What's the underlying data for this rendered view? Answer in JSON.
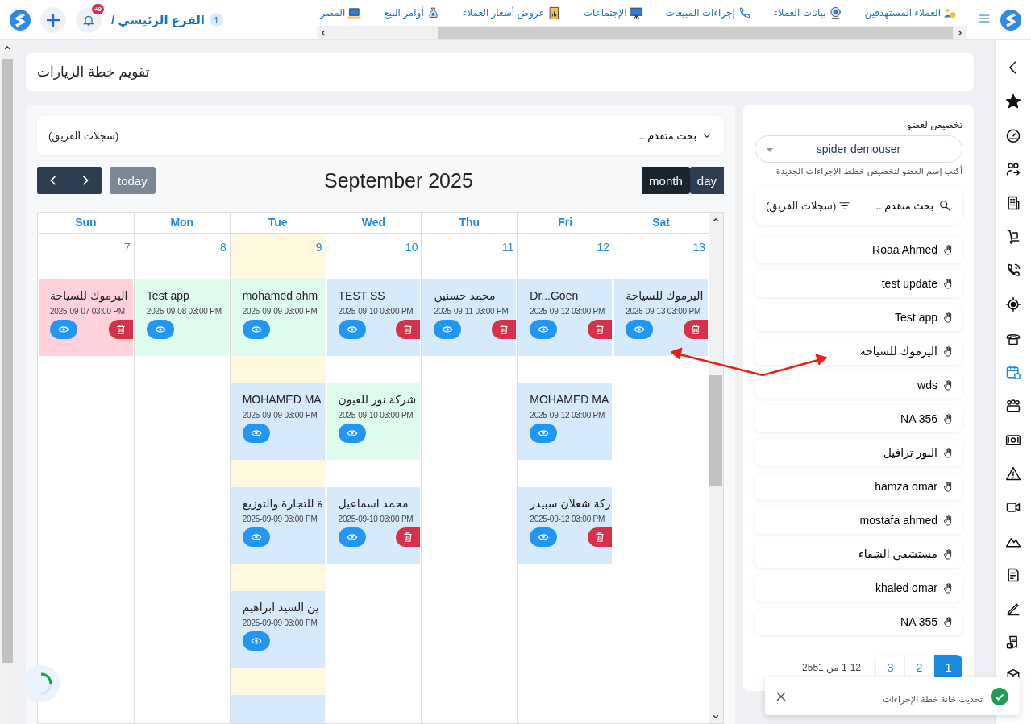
{
  "topbar": {
    "branch": {
      "label": "الفرع الرئيسي /",
      "count": "1"
    },
    "notifications": {
      "badge": "+9"
    },
    "nav_items": [
      {
        "label": "العملاء المستهدفين"
      },
      {
        "label": "بيانات العملاء"
      },
      {
        "label": "إجراءات المبيعات"
      },
      {
        "label": "الإجتماعات"
      },
      {
        "label": "عروض أسعار العملاء"
      },
      {
        "label": "أوامر البيع"
      },
      {
        "label": "المصر"
      }
    ]
  },
  "sidebar": {
    "items": [
      {
        "selected": false
      },
      {
        "selected": false
      },
      {
        "selected": false
      },
      {
        "selected": false
      },
      {
        "selected": false
      },
      {
        "selected": false
      },
      {
        "selected": false
      },
      {
        "selected": false
      },
      {
        "selected": true
      },
      {
        "selected": false
      },
      {
        "selected": false
      },
      {
        "selected": false
      },
      {
        "selected": false
      },
      {
        "selected": false
      },
      {
        "selected": false
      },
      {
        "selected": false
      },
      {
        "selected": false
      },
      {
        "selected": false
      }
    ]
  },
  "page_title": "تقويم خطة الزيارات",
  "calendar": {
    "filter": {
      "search_label": "بحث متقدم...",
      "scope": "(سجلات الفريق)"
    },
    "toolbar": {
      "today": {
        "label": "today",
        "disabled": true
      },
      "title": "September 2025",
      "views": [
        {
          "label": "day",
          "selected": false
        },
        {
          "label": "month",
          "selected": true
        }
      ]
    },
    "days": [
      {
        "name": "Sat",
        "date": "13",
        "today": false,
        "events": [
          {
            "title": "اليرموك للسياحة",
            "time": "2025-09-13 03:00 PM",
            "color": "#d6eafb",
            "deletable": true
          }
        ]
      },
      {
        "name": "Fri",
        "date": "12",
        "today": false,
        "events": [
          {
            "title": "Dr...Goen",
            "time": "2025-09-12 03:00 PM",
            "color": "#d6eafb",
            "deletable": true
          },
          {
            "title": "MOHAMED MA",
            "time": "2025-09-12 03:00 PM",
            "color": "#d6eafb",
            "deletable": false
          },
          {
            "title": "ركة شعلان سبيدر",
            "time": "2025-09-12 03:00 PM",
            "color": "#d6eafb",
            "deletable": true
          }
        ]
      },
      {
        "name": "Thu",
        "date": "11",
        "today": false,
        "events": [
          {
            "title": "محمد حسنين",
            "time": "2025-09-11 03:00 PM",
            "color": "#d6eafb",
            "deletable": true
          }
        ]
      },
      {
        "name": "Wed",
        "date": "10",
        "today": false,
        "events": [
          {
            "title": "TEST SS",
            "time": "2025-09-10 03:00 PM",
            "color": "#d6eafb",
            "deletable": true
          },
          {
            "title": "شركة نور للعيون",
            "time": "2025-09-10 03:00 PM",
            "color": "#dffbec",
            "deletable": false
          },
          {
            "title": "محمد اسماعيل",
            "time": "2025-09-10 03:00 PM",
            "color": "#d6eafb",
            "deletable": true
          }
        ]
      },
      {
        "name": "Tue",
        "date": "9",
        "today": true,
        "events": [
          {
            "title": "mohamed ahm",
            "time": "2025-09-09 03:00 PM",
            "color": "#dffbec",
            "deletable": false
          },
          {
            "title": "MOHAMED MA",
            "time": "2025-09-09 03:00 PM",
            "color": "#d6eafb",
            "deletable": false
          },
          {
            "title": "ة للتجارة والتوزيع",
            "time": "2025-09-09 03:00 PM",
            "color": "#d6eafb",
            "deletable": false
          },
          {
            "title": "ين السيد ابراهيم",
            "time": "2025-09-09 03:00 PM",
            "color": "#d6eafb",
            "deletable": false
          },
          {
            "color": "#d6eafb"
          }
        ]
      },
      {
        "name": "Mon",
        "date": "8",
        "today": false,
        "events": [
          {
            "title": "Test app",
            "time": "2025-09-08 03:00 PM",
            "color": "#dffbec",
            "deletable": false
          }
        ]
      },
      {
        "name": "Sun",
        "date": "7",
        "today": false,
        "events": [
          {
            "title": "اليرموك للسياحة",
            "time": "2025-09-07 03:00 PM",
            "color": "#ffd1da",
            "deletable": true
          }
        ]
      }
    ]
  },
  "assign_panel": {
    "label": "تخصيص لعضو",
    "member": "spider demouser",
    "hint": "أكتب إسم العضو لتخصيص خطط الإجراءات الجديدة",
    "search": {
      "label": "بحث متقدم...",
      "scope": "(سجلات الفريق)"
    },
    "members": [
      {
        "name": "Roaa Ahmed"
      },
      {
        "name": "test update"
      },
      {
        "name": "Test app"
      },
      {
        "name": "اليرموك للسياحة"
      },
      {
        "name": "wds"
      },
      {
        "name": "NA 356"
      },
      {
        "name": "النور ترافيل"
      },
      {
        "name": "hamza omar"
      },
      {
        "name": "mostafa ahmed"
      },
      {
        "name": "مستشفى الشفاء"
      },
      {
        "name": "khaled omar"
      },
      {
        "name": "NA 355"
      }
    ],
    "pagination": {
      "range": "1-12 من 2551",
      "pages": [
        {
          "label": "1",
          "selected": true
        },
        {
          "label": "2",
          "selected": false
        },
        {
          "label": "3",
          "selected": false
        }
      ]
    }
  },
  "toast": {
    "message": "تحديث خانة خطة الإجراءات"
  }
}
